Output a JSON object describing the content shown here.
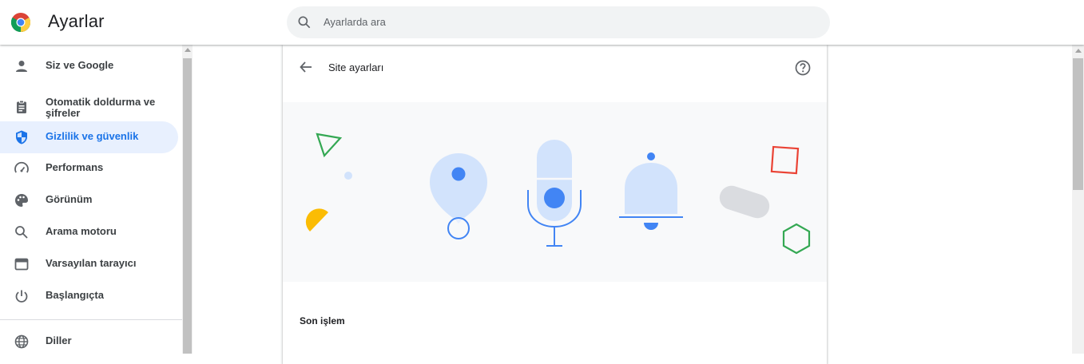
{
  "header": {
    "title": "Ayarlar",
    "search_placeholder": "Ayarlarda ara"
  },
  "sidebar": {
    "items": [
      {
        "label": "Siz ve Google",
        "icon": "person-icon",
        "active": false
      },
      {
        "label": "Otomatik doldurma ve şifreler",
        "icon": "clipboard-icon",
        "active": false
      },
      {
        "label": "Gizlilik ve güvenlik",
        "icon": "shield-icon",
        "active": true
      },
      {
        "label": "Performans",
        "icon": "speedometer-icon",
        "active": false
      },
      {
        "label": "Görünüm",
        "icon": "palette-icon",
        "active": false
      },
      {
        "label": "Arama motoru",
        "icon": "search-icon",
        "active": false
      },
      {
        "label": "Varsayılan tarayıcı",
        "icon": "browser-icon",
        "active": false
      },
      {
        "label": "Başlangıçta",
        "icon": "power-icon",
        "active": false
      },
      {
        "label": "Diller",
        "icon": "globe-icon",
        "active": false
      }
    ]
  },
  "card": {
    "title": "Site ayarları",
    "section_title": "Son işlem"
  },
  "colors": {
    "accent": "#1a73e8",
    "active_bg": "#e8f0fe",
    "hero_bg": "#f8f9fa",
    "google_blue": "#4285f4",
    "google_red": "#ea4335",
    "google_yellow": "#fbbc04",
    "google_green": "#34a853"
  }
}
